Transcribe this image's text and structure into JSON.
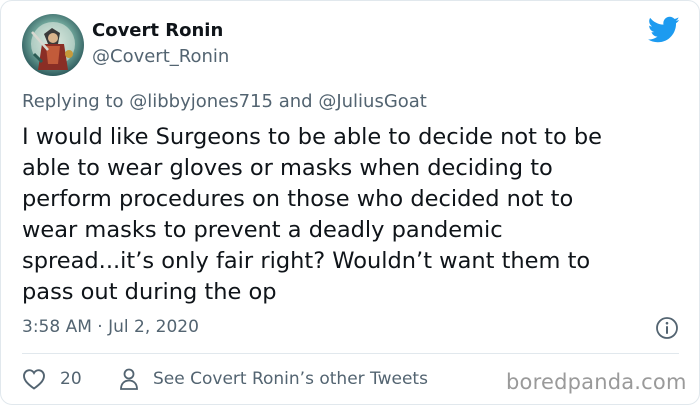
{
  "author": {
    "display_name": "Covert Ronin",
    "handle": "@Covert_Ronin",
    "avatar_icon": "avatar-icon"
  },
  "reply": {
    "prefix": "Replying to",
    "mention_1": "@libbyjones715",
    "conjunction": "and",
    "mention_2": "@JuliusGoat"
  },
  "tweet": {
    "text": "I would like Surgeons to be able to decide not to be\nable to wear gloves or masks when deciding to\nperform procedures on those who decided not to\nwear masks to prevent a deadly pandemic\nspread...it’s only fair right? Wouldn’t want them to\npass out during the op",
    "timestamp": "3:58 AM · Jul 2, 2020"
  },
  "actions": {
    "like_count": "20",
    "see_other_label": "See Covert Ronin’s other Tweets"
  },
  "watermark": "boredpanda.com",
  "colors": {
    "twitter_blue": "#1d9bf0",
    "secondary_text": "#536471",
    "primary_text": "#0f1419",
    "divider": "#e1e8ed",
    "watermark": "#9a9a9a"
  }
}
